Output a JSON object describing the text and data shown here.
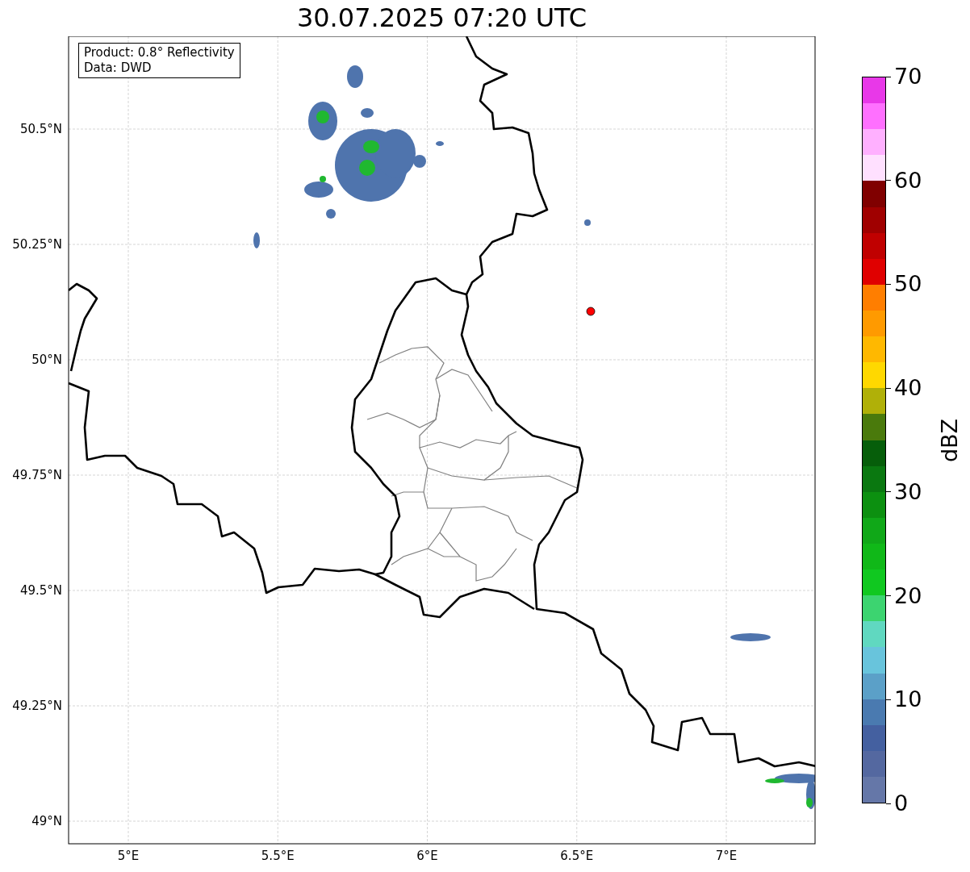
{
  "title": "30.07.2025 07:20 UTC",
  "info_box": [
    "Product: 0.8° Reflectivity",
    "Data: DWD"
  ],
  "map": {
    "lat_ticks": [
      "50.5°N",
      "50.25°N",
      "50°N",
      "49.75°N",
      "49.5°N",
      "49.25°N",
      "49°N"
    ],
    "lon_ticks": [
      "5°E",
      "5.5°E",
      "6°E",
      "6.5°E",
      "7°E"
    ]
  },
  "colorbar": {
    "label": "dBZ",
    "ticks": [
      "70",
      "60",
      "50",
      "40",
      "30",
      "20",
      "10",
      "0"
    ],
    "bins": [
      {
        "color": "#e838e8"
      },
      {
        "color": "#ff70ff"
      },
      {
        "color": "#ffb0ff"
      },
      {
        "color": "#ffe0ff"
      },
      {
        "color": "#800000"
      },
      {
        "color": "#a00000"
      },
      {
        "color": "#c00000"
      },
      {
        "color": "#e00000"
      },
      {
        "color": "#ff7e00"
      },
      {
        "color": "#ff9a00"
      },
      {
        "color": "#ffb800"
      },
      {
        "color": "#ffd800"
      },
      {
        "color": "#b0b008"
      },
      {
        "color": "#4a7a0c"
      },
      {
        "color": "#065e0a"
      },
      {
        "color": "#0a7810"
      },
      {
        "color": "#0c9010"
      },
      {
        "color": "#10a818"
      },
      {
        "color": "#10b818"
      },
      {
        "color": "#10c820"
      },
      {
        "color": "#3cd470"
      },
      {
        "color": "#60d8c0"
      },
      {
        "color": "#68c4dc"
      },
      {
        "color": "#5ba0c8"
      },
      {
        "color": "#4a7ab0"
      },
      {
        "color": "#4460a0"
      },
      {
        "color": "#5468a0"
      },
      {
        "color": "#6577a8"
      }
    ]
  }
}
